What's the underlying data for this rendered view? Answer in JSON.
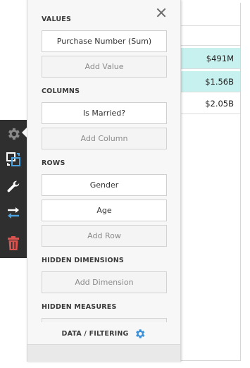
{
  "table": {
    "rows": [
      {
        "value": "$491M",
        "highlight": true
      },
      {
        "value": "$1.56B",
        "highlight": true
      },
      {
        "value": "$2.05B",
        "highlight": false
      }
    ]
  },
  "toolbar": {
    "items": [
      {
        "icon": "gear-icon",
        "color": "#8a8a8a"
      },
      {
        "icon": "layout-convert-icon",
        "color": "#4da3e0"
      },
      {
        "icon": "wrench-icon",
        "color": "#ffffff"
      },
      {
        "icon": "swap-arrows-icon",
        "color": "#4da3e0"
      },
      {
        "icon": "trash-icon",
        "color": "#d9534f"
      }
    ]
  },
  "panel": {
    "values": {
      "title": "VALUES",
      "fields": [
        "Purchase Number (Sum)"
      ],
      "add_label": "Add Value"
    },
    "columns": {
      "title": "COLUMNS",
      "fields": [
        "Is Married?"
      ],
      "add_label": "Add Column"
    },
    "rows": {
      "title": "ROWS",
      "fields": [
        "Gender",
        "Age"
      ],
      "add_label": "Add Row"
    },
    "hidden_dimensions": {
      "title": "HIDDEN DIMENSIONS",
      "add_label": "Add Dimension"
    },
    "hidden_measures": {
      "title": "HIDDEN MEASURES"
    },
    "footer": {
      "label": "DATA / FILTERING",
      "icon": "gear-icon",
      "icon_color": "#3b8fd9"
    }
  },
  "colors": {
    "highlight": "#c6f1ee",
    "toolbar_bg": "#2f2f2f",
    "panel_bg": "#f7f7f7"
  }
}
